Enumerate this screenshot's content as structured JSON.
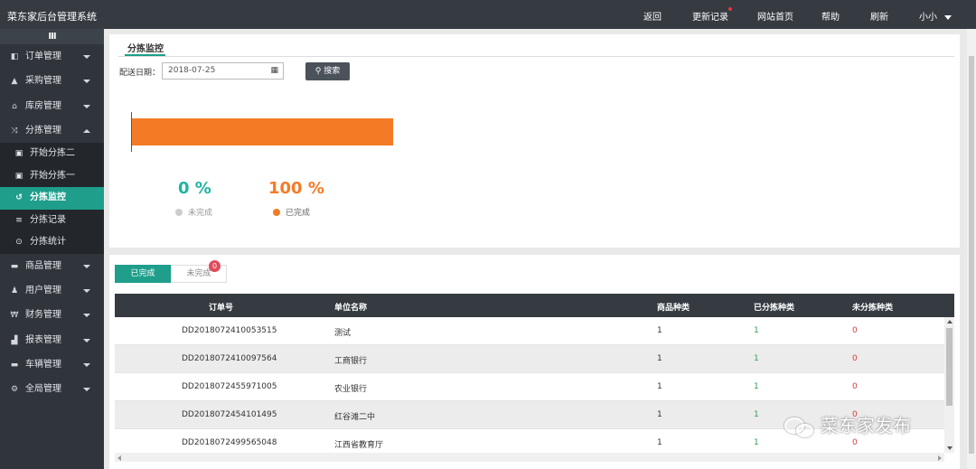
{
  "app": {
    "title": "菜东家后台管理系统"
  },
  "topnav": {
    "items": [
      "返回",
      "更新记录",
      "网站首页",
      "帮助",
      "刷新"
    ],
    "user": "小小"
  },
  "sidebar": {
    "collapse_label": "III",
    "items": [
      {
        "label": "订单管理",
        "icon": "copy-icon",
        "glyph": "◧"
      },
      {
        "label": "采购管理",
        "icon": "shopping-bag-icon",
        "glyph": "▲"
      },
      {
        "label": "库房管理",
        "icon": "bank-icon",
        "glyph": "⌂"
      },
      {
        "label": "分拣管理",
        "icon": "shuffle-icon",
        "glyph": "⤨",
        "expanded": true
      }
    ],
    "subitems": [
      {
        "label": "开始分拣二",
        "icon": "square-play-icon",
        "glyph": "▣"
      },
      {
        "label": "开始分拣一",
        "icon": "square-play-icon",
        "glyph": "▣"
      },
      {
        "label": "分拣监控",
        "icon": "history-icon",
        "glyph": "↺",
        "active": true
      },
      {
        "label": "分拣记录",
        "icon": "list-icon",
        "glyph": "≡"
      },
      {
        "label": "分拣统计",
        "icon": "target-icon",
        "glyph": "⊙"
      }
    ],
    "items_after": [
      {
        "label": "商品管理",
        "icon": "car-icon",
        "glyph": "▬"
      },
      {
        "label": "用户管理",
        "icon": "users-icon",
        "glyph": "♟"
      },
      {
        "label": "财务管理",
        "icon": "yen-icon",
        "glyph": "₩"
      },
      {
        "label": "报表管理",
        "icon": "area-chart-icon",
        "glyph": "▟"
      },
      {
        "label": "车辆管理",
        "icon": "car-icon",
        "glyph": "▬"
      },
      {
        "label": "全局管理",
        "icon": "cogs-icon",
        "glyph": "⚙"
      }
    ]
  },
  "monitor": {
    "tab": "分拣监控",
    "date_label": "配送日期：",
    "date_value": "2018-07-25",
    "search_label": "搜索",
    "progress_done_fraction": 1.0,
    "pending_pct": "0 %",
    "done_pct": "100 %",
    "pending_label": "未完成",
    "done_label": "已完成",
    "colors": {
      "done": "#f47b25",
      "pending": "#1fb3a1",
      "accent": "#1e9e8b"
    }
  },
  "orders": {
    "tab_done": "已完成",
    "tab_pending": "未完成",
    "pending_badge": "0",
    "columns": [
      "订单号",
      "单位名称",
      "商品种类",
      "已分拣种类",
      "未分拣种类"
    ],
    "rows": [
      {
        "id": "DD2018072410053515",
        "unit": "测试",
        "kinds": "1",
        "sorted": "1",
        "unsorted": "0"
      },
      {
        "id": "DD2018072410097564",
        "unit": "工商银行",
        "kinds": "1",
        "sorted": "1",
        "unsorted": "0"
      },
      {
        "id": "DD2018072455971005",
        "unit": "农业银行",
        "kinds": "1",
        "sorted": "1",
        "unsorted": "0"
      },
      {
        "id": "DD2018072454101495",
        "unit": "红谷滩二中",
        "kinds": "1",
        "sorted": "1",
        "unsorted": "0"
      },
      {
        "id": "DD2018072499565048",
        "unit": "江西省教育厅",
        "kinds": "1",
        "sorted": "1",
        "unsorted": "0"
      }
    ]
  },
  "watermark": "菜东家发布"
}
